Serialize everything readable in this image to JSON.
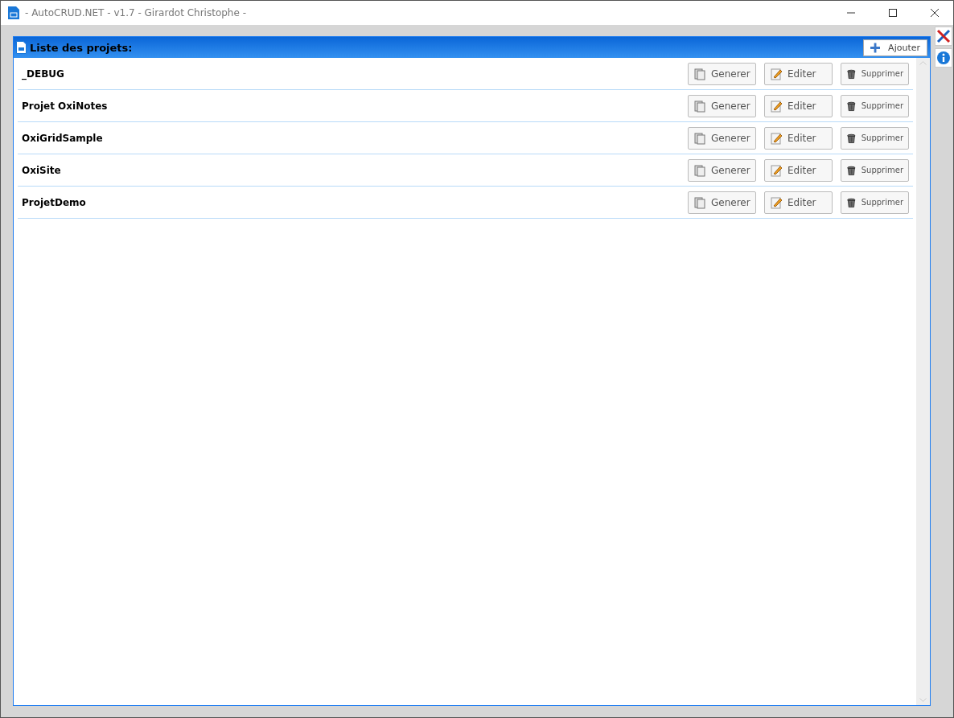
{
  "window": {
    "title": "- AutoCRUD.NET - v1.7 - Girardot Christophe -"
  },
  "panel": {
    "title": "Liste des projets:",
    "add_button": "Ajouter"
  },
  "projects": [
    {
      "name": "_DEBUG",
      "actions": [
        {
          "kind": "generate",
          "label": "Generer"
        },
        {
          "kind": "edit",
          "label": "Editer"
        },
        {
          "kind": "delete",
          "label": "Supprimer"
        }
      ]
    },
    {
      "name": "Projet OxiNotes",
      "actions": [
        {
          "kind": "generate",
          "label": "Generer"
        },
        {
          "kind": "edit",
          "label": "Editer"
        },
        {
          "kind": "delete",
          "label": "Supprimer"
        }
      ]
    },
    {
      "name": "OxiGridSample",
      "actions": [
        {
          "kind": "generate",
          "label": "Generer"
        },
        {
          "kind": "edit",
          "label": "Editer"
        },
        {
          "kind": "delete",
          "label": "Supprimer"
        }
      ]
    },
    {
      "name": "OxiSite",
      "actions": [
        {
          "kind": "generate",
          "label": "Generer"
        },
        {
          "kind": "edit",
          "label": "Editer"
        },
        {
          "kind": "delete",
          "label": "Supprimer"
        }
      ]
    },
    {
      "name": "ProjetDemo",
      "actions": [
        {
          "kind": "generate",
          "label": "Generer"
        },
        {
          "kind": "edit",
          "label": "Editer"
        },
        {
          "kind": "delete",
          "label": "Supprimer"
        }
      ]
    }
  ]
}
